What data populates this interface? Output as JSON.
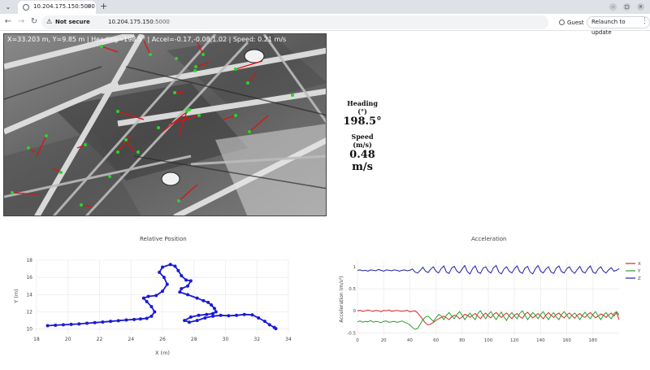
{
  "browser": {
    "tab_title": "10.204.175.150:5000",
    "security_label": "Not secure",
    "url_host": "10.204.175.150",
    "url_port": ":5000",
    "guest_label": "Guest",
    "relaunch_label": "Relaunch to update"
  },
  "camera": {
    "overlay": "X=33.203 m, Y=9.85  m | Heading=198.5° | Accel=-0.17,-0.08,1.02 | Speed: 0.21 m/s"
  },
  "stats": {
    "heading_label": "Heading (°)",
    "heading_value": "198.5°",
    "speed_label": "Speed (m/s)",
    "speed_value": "0.48 m/s"
  },
  "position_plot": {
    "title": "Relative Position",
    "xlabel": "X (m)",
    "ylabel": "Y (m)"
  },
  "accel_plot": {
    "title": "Acceleration",
    "ylabel": "Acceleration (m/s²)"
  },
  "chart_data": [
    {
      "type": "scatter",
      "title": "Relative Position",
      "xlabel": "X (m)",
      "ylabel": "Y (m)",
      "xlim": [
        18,
        34
      ],
      "ylim": [
        9.5,
        18
      ],
      "xticks": [
        18,
        20,
        22,
        24,
        26,
        28,
        30,
        32,
        34
      ],
      "yticks": [
        10,
        12,
        14,
        16,
        18
      ],
      "grid": true,
      "color": "#1a1ad6",
      "x": [
        18.7,
        19.2,
        19.7,
        20.2,
        20.7,
        21.2,
        21.7,
        22.2,
        22.7,
        23.2,
        23.7,
        24.2,
        24.6,
        25.0,
        25.3,
        25.5,
        25.3,
        25.0,
        24.8,
        25.1,
        25.6,
        26.0,
        26.3,
        26.1,
        25.8,
        26.0,
        26.5,
        26.8,
        27.0,
        27.2,
        27.5,
        27.8,
        27.6,
        27.2,
        27.1,
        27.6,
        28.2,
        28.6,
        28.9,
        29.1,
        29.3,
        29.4,
        29.2,
        28.8,
        28.3,
        27.8,
        27.4,
        27.7,
        28.2,
        28.7,
        29.2,
        29.7,
        30.2,
        30.7,
        31.2,
        31.7,
        32.1,
        32.5,
        32.8,
        33.1,
        33.2
      ],
      "y": [
        10.4,
        10.45,
        10.5,
        10.55,
        10.6,
        10.68,
        10.75,
        10.82,
        10.9,
        10.98,
        11.06,
        11.12,
        11.18,
        11.25,
        11.5,
        12.0,
        12.6,
        13.2,
        13.6,
        13.8,
        13.9,
        14.4,
        15.2,
        16.0,
        16.6,
        17.2,
        17.5,
        17.3,
        16.8,
        16.2,
        15.7,
        15.6,
        15.0,
        14.7,
        14.3,
        14.0,
        13.6,
        13.3,
        13.1,
        12.8,
        12.4,
        12.0,
        11.8,
        11.7,
        11.6,
        11.4,
        11.0,
        10.8,
        11.0,
        11.3,
        11.5,
        11.6,
        11.55,
        11.6,
        11.7,
        11.65,
        11.3,
        10.9,
        10.5,
        10.2,
        10.05
      ]
    },
    {
      "type": "line",
      "title": "Acceleration",
      "xlabel": "",
      "ylabel": "Acceleration (m/s²)",
      "xlim": [
        0,
        200
      ],
      "ylim": [
        -0.55,
        1.15
      ],
      "xticks": [
        0,
        20,
        40,
        60,
        80,
        100,
        120,
        140,
        160,
        180
      ],
      "yticks": [
        -0.5,
        0,
        0.5,
        1
      ],
      "grid": true,
      "legend": "top-right",
      "series": [
        {
          "name": "X",
          "color": "#d62728",
          "values": [
            0.0,
            0.01,
            -0.01,
            0.0,
            0.02,
            0.0,
            -0.01,
            0.01,
            0.0,
            -0.02,
            0.01,
            0.0,
            0.02,
            -0.01,
            0.0,
            0.01,
            0.0,
            -0.01,
            0.0,
            0.01,
            -0.02,
            -0.01,
            0.0,
            -0.05,
            -0.12,
            -0.2,
            -0.28,
            -0.32,
            -0.3,
            -0.26,
            -0.22,
            -0.18,
            -0.15,
            -0.12,
            -0.16,
            -0.2,
            -0.14,
            -0.1,
            -0.12,
            -0.18,
            -0.14,
            -0.08,
            -0.1,
            -0.15,
            -0.1,
            -0.06,
            -0.12,
            -0.18,
            -0.1,
            -0.05,
            -0.12,
            -0.16,
            -0.08,
            -0.04,
            -0.1,
            -0.15,
            -0.09,
            -0.05,
            -0.12,
            -0.18,
            -0.1,
            -0.06,
            -0.13,
            -0.17,
            -0.08,
            -0.03,
            -0.1,
            -0.16,
            -0.11,
            -0.06,
            -0.12,
            -0.18,
            -0.1,
            -0.04,
            -0.1,
            -0.15,
            -0.08,
            -0.05,
            -0.12,
            -0.16,
            -0.09,
            -0.05,
            -0.11,
            -0.17,
            -0.1,
            -0.06,
            -0.12,
            -0.15,
            -0.08,
            -0.04,
            -0.1,
            -0.16,
            -0.12,
            -0.07,
            -0.1,
            -0.15,
            -0.09,
            -0.05,
            -0.12,
            -0.04,
            -0.2
          ]
        },
        {
          "name": "Y",
          "color": "#2ca02c",
          "values": [
            -0.25,
            -0.23,
            -0.26,
            -0.24,
            -0.25,
            -0.22,
            -0.26,
            -0.24,
            -0.25,
            -0.27,
            -0.24,
            -0.23,
            -0.26,
            -0.25,
            -0.24,
            -0.26,
            -0.25,
            -0.23,
            -0.26,
            -0.28,
            -0.32,
            -0.38,
            -0.42,
            -0.4,
            -0.3,
            -0.2,
            -0.14,
            -0.12,
            -0.18,
            -0.24,
            -0.16,
            -0.08,
            -0.12,
            -0.2,
            -0.1,
            -0.04,
            -0.12,
            -0.18,
            -0.08,
            -0.02,
            -0.1,
            -0.2,
            -0.12,
            -0.05,
            -0.14,
            -0.2,
            -0.06,
            0.0,
            -0.1,
            -0.18,
            -0.08,
            -0.02,
            -0.12,
            -0.2,
            -0.1,
            -0.03,
            -0.14,
            -0.22,
            -0.1,
            -0.04,
            -0.12,
            -0.18,
            -0.06,
            0.0,
            -0.1,
            -0.2,
            -0.12,
            -0.04,
            -0.1,
            -0.18,
            -0.08,
            -0.02,
            -0.12,
            -0.2,
            -0.1,
            -0.04,
            -0.14,
            -0.2,
            -0.08,
            -0.02,
            -0.1,
            -0.18,
            -0.1,
            -0.05,
            -0.12,
            -0.2,
            -0.1,
            -0.03,
            -0.12,
            -0.18,
            -0.08,
            -0.02,
            -0.12,
            -0.2,
            -0.1,
            -0.04,
            -0.12,
            -0.18,
            -0.06,
            -0.02,
            -0.1
          ]
        },
        {
          "name": "Z",
          "color": "#1f1fa8",
          "values": [
            0.92,
            0.93,
            0.91,
            0.92,
            0.9,
            0.93,
            0.92,
            0.91,
            0.94,
            0.92,
            0.9,
            0.93,
            0.92,
            0.91,
            0.93,
            0.92,
            0.9,
            0.92,
            0.93,
            0.91,
            0.92,
            0.95,
            0.88,
            0.86,
            0.92,
            0.99,
            0.9,
            0.87,
            0.95,
            1.0,
            0.9,
            0.86,
            0.96,
            1.02,
            0.88,
            0.85,
            0.97,
            1.01,
            0.9,
            0.86,
            0.95,
            1.03,
            0.89,
            0.84,
            0.96,
            1.02,
            0.88,
            0.85,
            0.97,
            1.0,
            0.9,
            0.86,
            0.98,
            1.03,
            0.88,
            0.84,
            0.95,
            1.0,
            0.9,
            0.86,
            0.96,
            1.02,
            0.89,
            0.85,
            0.97,
            1.01,
            0.88,
            0.84,
            0.96,
            1.03,
            0.9,
            0.86,
            0.95,
            1.0,
            0.88,
            0.85,
            0.97,
            1.02,
            0.89,
            0.86,
            0.96,
            1.0,
            0.9,
            0.85,
            0.94,
            1.01,
            0.89,
            0.86,
            0.96,
            1.02,
            0.88,
            0.85,
            0.95,
            1.0,
            0.9,
            0.86,
            0.93,
            0.98,
            0.9,
            0.92,
            0.96
          ]
        }
      ]
    }
  ]
}
